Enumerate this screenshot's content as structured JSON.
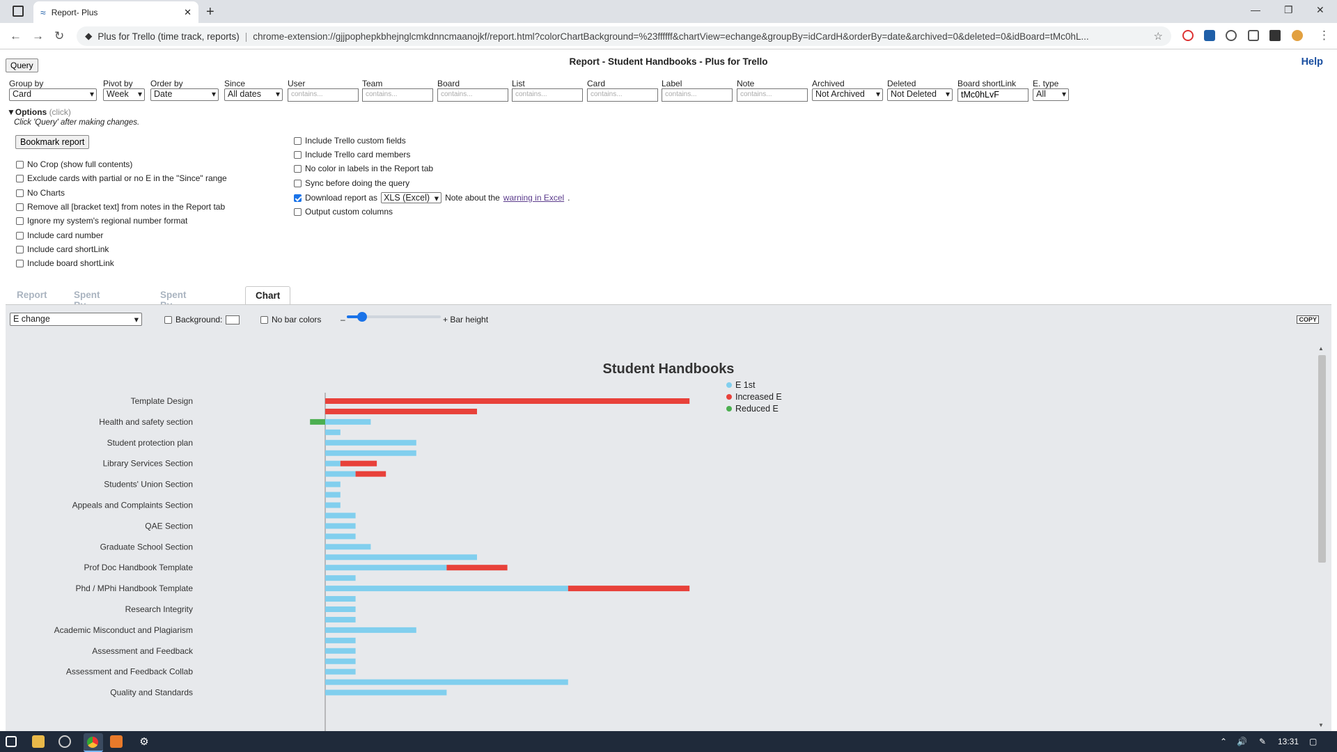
{
  "browser": {
    "tab_title": "Report- Plus",
    "site_label": "Plus for Trello (time track, reports)",
    "url": "chrome-extension://gjjpophepkbhejnglcmkdnncmaanojkf/report.html?colorChartBackground=%23ffffff&chartView=echange&groupBy=idCardH&orderBy=date&archived=0&deleted=0&idBoard=tMc0hL..."
  },
  "page": {
    "query_label": "Query",
    "title": "Report - Student Handbooks - Plus for Trello",
    "help_label": "Help"
  },
  "filters": [
    {
      "label": "Group by",
      "value": "Card",
      "kind": "select"
    },
    {
      "label": "Pivot by",
      "value": "Week",
      "kind": "select"
    },
    {
      "label": "Order by",
      "value": "Date",
      "kind": "select"
    },
    {
      "label": "Since",
      "value": "All dates",
      "kind": "select"
    },
    {
      "label": "User",
      "placeholder": "contains...",
      "kind": "input"
    },
    {
      "label": "Team",
      "placeholder": "contains...",
      "kind": "input"
    },
    {
      "label": "Board",
      "placeholder": "contains...",
      "kind": "input"
    },
    {
      "label": "List",
      "placeholder": "contains...",
      "kind": "input"
    },
    {
      "label": "Card",
      "placeholder": "contains...",
      "kind": "input"
    },
    {
      "label": "Label",
      "placeholder": "contains...",
      "kind": "input"
    },
    {
      "label": "Note",
      "placeholder": "contains...",
      "kind": "input"
    },
    {
      "label": "Archived",
      "value": "Not Archived",
      "kind": "select"
    },
    {
      "label": "Deleted",
      "value": "Not Deleted",
      "kind": "select"
    },
    {
      "label": "Board shortLink",
      "value": "tMc0hLvF",
      "kind": "input-value"
    },
    {
      "label": "E. type",
      "value": "All",
      "kind": "select"
    }
  ],
  "options": {
    "heading": "Options",
    "hint": "(click)",
    "note": "Click 'Query' after making changes.",
    "bookmark_label": "Bookmark report",
    "left": [
      {
        "label": "No Crop (show full contents)",
        "checked": false
      },
      {
        "label": "Exclude cards with partial or no E in the \"Since\" range",
        "checked": false
      },
      {
        "label": "No Charts",
        "checked": false
      },
      {
        "label": "Remove all [bracket text] from notes in the Report tab",
        "checked": false
      },
      {
        "label": "Ignore my system's regional number format",
        "checked": false
      },
      {
        "label": "Include card number",
        "checked": false
      },
      {
        "label": "Include card shortLink",
        "checked": false
      },
      {
        "label": "Include board shortLink",
        "checked": false
      }
    ],
    "right": [
      {
        "label": "Include Trello custom fields",
        "checked": false
      },
      {
        "label": "Include Trello card members",
        "checked": false
      },
      {
        "label": "No color in labels in the Report tab",
        "checked": false
      },
      {
        "label": "Sync before doing the query",
        "checked": false
      },
      {
        "label": "Download report as",
        "checked": true
      },
      {
        "label": "Output custom columns",
        "checked": false
      }
    ],
    "download_format": "XLS (Excel)",
    "note_about": "Note about the",
    "warning_link": "warning in Excel",
    "period": "."
  },
  "report_tabs": [
    "Report",
    "Spent By User",
    "Spent By Board",
    "Chart"
  ],
  "chart_controls": {
    "view": "E change",
    "background_label": "Background:",
    "no_bar_colors_label": "No bar colors",
    "minus": "–",
    "bar_height_label": "+ Bar height",
    "copy_label": "COPY"
  },
  "colors": {
    "e1st": "#81cfee",
    "increased": "#e8413a",
    "reduced": "#4caf50"
  },
  "chart_data": {
    "type": "bar",
    "orientation": "horizontal-stacked",
    "title": "Student Handbooks",
    "legend": [
      "E 1st",
      "Increased E",
      "Reduced E"
    ],
    "legend_position": "top-center",
    "categories_labeled": [
      "Template Design",
      "Health and safety section",
      "Student protection plan",
      "Library Services Section",
      "Students' Union Section",
      "Appeals and Complaints Section",
      "QAE Section",
      "Graduate School Section",
      "Prof Doc Handbook Template",
      "Phd / MPhi Handbook Template",
      "Research Integrity",
      "Academic Misconduct and Plagiarism",
      "Assessment and Feedback",
      "Assessment and Feedback Collab",
      "Quality and Standards"
    ],
    "note": "bars alternate; every second bar row carries a label",
    "bars": [
      {
        "row": "Template Design",
        "e1st": 0,
        "increased": 24,
        "reduced": 0
      },
      {
        "row": "",
        "e1st": 0,
        "increased": 10,
        "reduced": 0
      },
      {
        "row": "Health and safety section",
        "e1st": 3,
        "increased": 0,
        "reduced": 1
      },
      {
        "row": "",
        "e1st": 1,
        "increased": 0,
        "reduced": 0
      },
      {
        "row": "Student protection plan",
        "e1st": 6,
        "increased": 0,
        "reduced": 0
      },
      {
        "row": "",
        "e1st": 6,
        "increased": 0,
        "reduced": 0
      },
      {
        "row": "Library Services Section",
        "e1st": 1,
        "increased": 2.4,
        "reduced": 0
      },
      {
        "row": "",
        "e1st": 2,
        "increased": 2,
        "reduced": 0
      },
      {
        "row": "Students' Union Section",
        "e1st": 1,
        "increased": 0,
        "reduced": 0
      },
      {
        "row": "",
        "e1st": 1,
        "increased": 0,
        "reduced": 0
      },
      {
        "row": "Appeals and Complaints Section",
        "e1st": 1,
        "increased": 0,
        "reduced": 0
      },
      {
        "row": "",
        "e1st": 2,
        "increased": 0,
        "reduced": 0
      },
      {
        "row": "QAE Section",
        "e1st": 2,
        "increased": 0,
        "reduced": 0
      },
      {
        "row": "",
        "e1st": 2,
        "increased": 0,
        "reduced": 0
      },
      {
        "row": "Graduate School Section",
        "e1st": 3,
        "increased": 0,
        "reduced": 0
      },
      {
        "row": "",
        "e1st": 10,
        "increased": 0,
        "reduced": 0
      },
      {
        "row": "Prof Doc Handbook Template",
        "e1st": 8,
        "increased": 4,
        "reduced": 0
      },
      {
        "row": "",
        "e1st": 2,
        "increased": 0,
        "reduced": 0
      },
      {
        "row": "Phd / MPhi Handbook Template",
        "e1st": 16,
        "increased": 8,
        "reduced": 0
      },
      {
        "row": "",
        "e1st": 2,
        "increased": 0,
        "reduced": 0
      },
      {
        "row": "Research Integrity",
        "e1st": 2,
        "increased": 0,
        "reduced": 0
      },
      {
        "row": "",
        "e1st": 2,
        "increased": 0,
        "reduced": 0
      },
      {
        "row": "Academic Misconduct and Plagiarism",
        "e1st": 6,
        "increased": 0,
        "reduced": 0
      },
      {
        "row": "",
        "e1st": 2,
        "increased": 0,
        "reduced": 0
      },
      {
        "row": "Assessment and Feedback",
        "e1st": 2,
        "increased": 0,
        "reduced": 0
      },
      {
        "row": "",
        "e1st": 2,
        "increased": 0,
        "reduced": 0
      },
      {
        "row": "Assessment and Feedback Collab",
        "e1st": 2,
        "increased": 0,
        "reduced": 0
      },
      {
        "row": "",
        "e1st": 16,
        "increased": 0,
        "reduced": 0
      },
      {
        "row": "Quality and Standards",
        "e1st": 8,
        "increased": 0,
        "reduced": 0
      }
    ]
  },
  "taskbar": {
    "clock": "13:31"
  }
}
